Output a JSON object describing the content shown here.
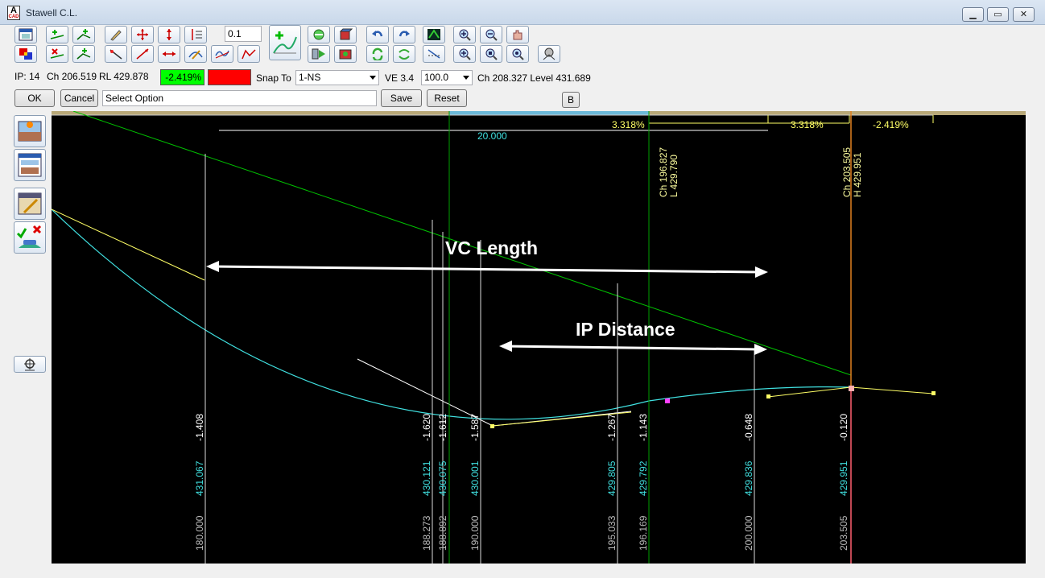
{
  "window": {
    "title": "Stawell C.L.",
    "icon_letter": "A",
    "icon_sub": "CAD",
    "min": "▁",
    "max": "▭",
    "close": "✕"
  },
  "toolbar": {
    "step_value": "0.1"
  },
  "status": {
    "ip": "IP: 14",
    "ch": "Ch 206.519",
    "rl": "RL 429.878",
    "grade": "-2.419%",
    "grade_color": "#00ff00",
    "red_swatch": "#ff0000",
    "snap_label": "Snap To",
    "snap_value": "1-NS",
    "ve": "VE 3.4",
    "scale_value": "100.0",
    "cursor": "Ch 208.327 Level 431.689"
  },
  "actions": {
    "ok": "OK",
    "cancel": "Cancel",
    "prompt": "Select Option",
    "save": "Save",
    "reset": "Reset",
    "b": "B"
  },
  "profile": {
    "grades": [
      "3.318%",
      "3.318%",
      "-2.419%"
    ],
    "vc_dim": "20.000",
    "ip_ch": "Ch 203.505",
    "ip_h": "H 429.951",
    "vc_ch": "Ch 196.827",
    "vc_l": "L 429.790",
    "annotation_vc": "VC Length",
    "annotation_ip": "IP Distance",
    "stations": [
      {
        "ch": "180.000",
        "level": "431.067",
        "diff": "-1.408"
      },
      {
        "ch": "188.273",
        "level": "430.121",
        "diff": "-1.620"
      },
      {
        "ch": "188.892",
        "level": "430.075",
        "diff": "-1.612"
      },
      {
        "ch": "190.000",
        "level": "430.001",
        "diff": "-1.587"
      },
      {
        "ch": "195.033",
        "level": "429.805",
        "diff": "-1.267"
      },
      {
        "ch": "196.169",
        "level": "429.792",
        "diff": "-1.143"
      },
      {
        "ch": "200.000",
        "level": "429.836",
        "diff": "-0.648"
      },
      {
        "ch": "203.505",
        "level": "429.951",
        "diff": "-0.120"
      }
    ]
  }
}
